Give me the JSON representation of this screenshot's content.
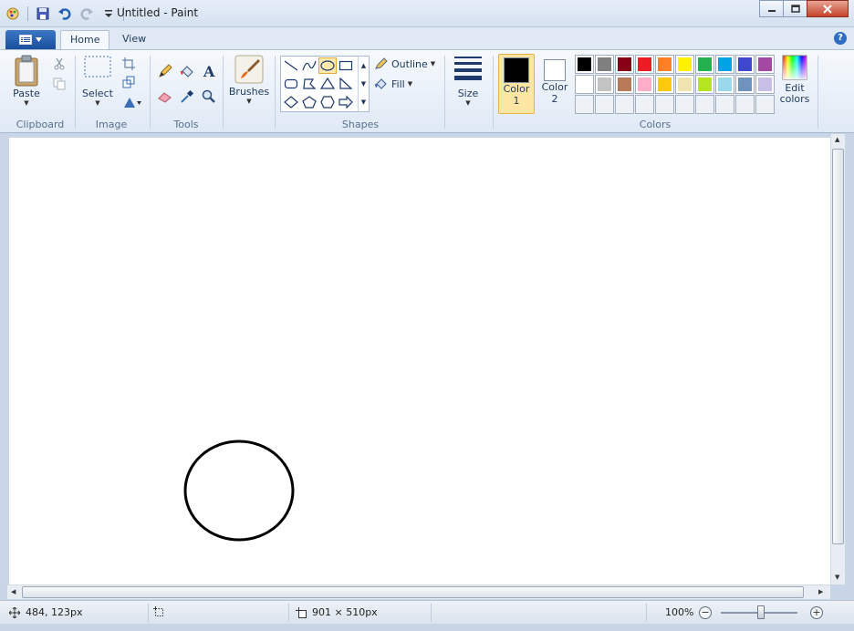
{
  "window": {
    "title": "Untitled - Paint"
  },
  "tabs": [
    {
      "label": "Home",
      "active": true
    },
    {
      "label": "View",
      "active": false
    }
  ],
  "ribbon": {
    "clipboard": {
      "paste_label": "Paste",
      "group_label": "Clipboard"
    },
    "image": {
      "select_label": "Select",
      "group_label": "Image"
    },
    "tools": {
      "group_label": "Tools"
    },
    "brushes": {
      "label": "Brushes"
    },
    "shapes": {
      "outline_label": "Outline",
      "fill_label": "Fill",
      "group_label": "Shapes",
      "selected_shape": "oval"
    },
    "size": {
      "label": "Size"
    },
    "colors": {
      "color1_label": "Color",
      "color1_num": "1",
      "color1_value": "#000000",
      "color2_label": "Color",
      "color2_num": "2",
      "color2_value": "#ffffff",
      "edit_label_1": "Edit",
      "edit_label_2": "colors",
      "group_label": "Colors",
      "palette_row1": [
        "#000000",
        "#7f7f7f",
        "#880015",
        "#ed1c24",
        "#ff7f27",
        "#fff200",
        "#22b14c",
        "#00a2e8",
        "#3f48cc",
        "#a349a4"
      ],
      "palette_row2": [
        "#ffffff",
        "#c3c3c3",
        "#b97a57",
        "#ffaec9",
        "#ffc90e",
        "#efe4b0",
        "#b5e61d",
        "#99d9ea",
        "#7092be",
        "#c8bfe7"
      ]
    }
  },
  "canvas": {
    "shape": "ellipse",
    "stroke_color": "#000000"
  },
  "status": {
    "cursor_position": "484, 123px",
    "canvas_size": "901 × 510px",
    "zoom": "100%"
  }
}
